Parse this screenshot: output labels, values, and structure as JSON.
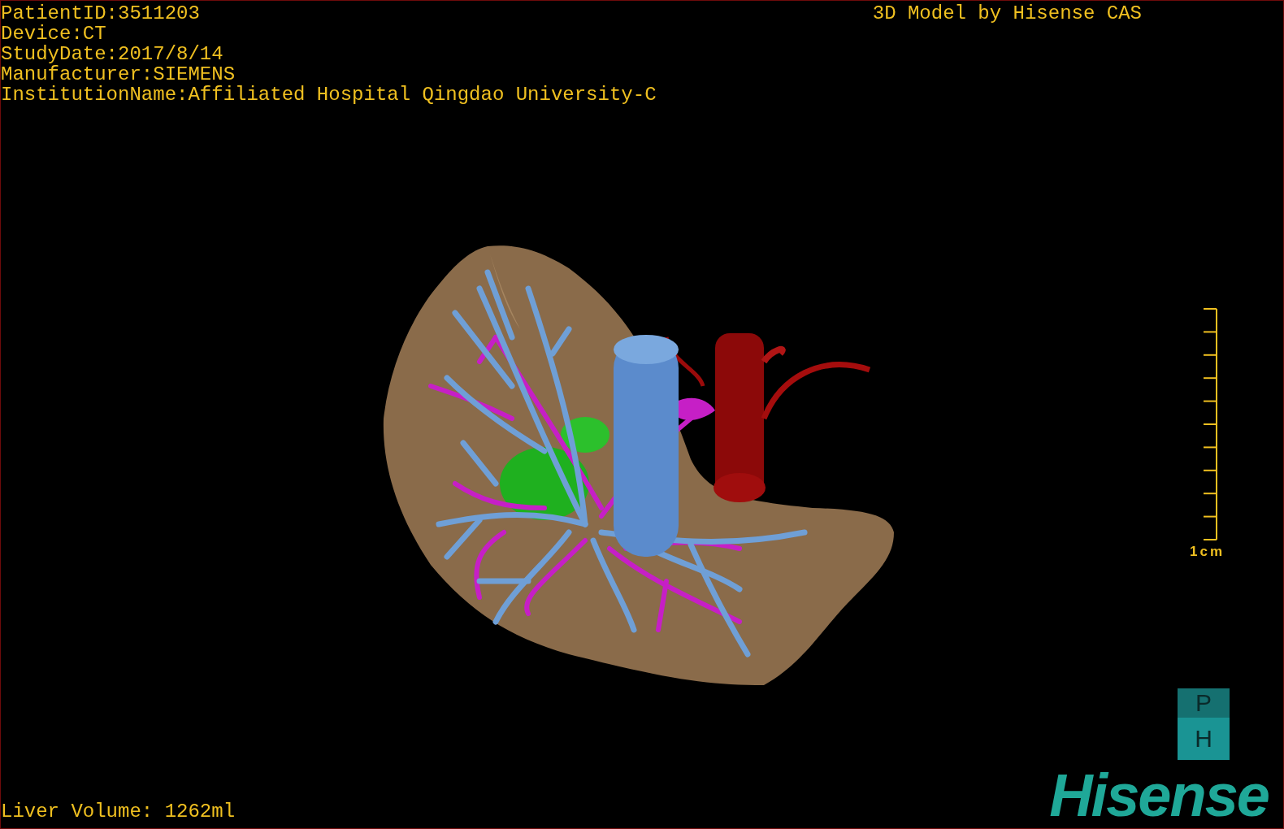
{
  "header": {
    "patient_info": [
      "PatientID:3511203",
      "Device:CT",
      "StudyDate:2017/8/14",
      "Manufacturer:SIEMENS",
      "InstitutionName:Affiliated Hospital Qingdao University-C"
    ],
    "model_credit": "3D Model by Hisense CAS"
  },
  "scale_bar": {
    "label": "1cm"
  },
  "footer": {
    "liver_volume": "Liver Volume: 1262ml",
    "badge": {
      "top": "P",
      "bottom": "H"
    },
    "logo": "Hisense"
  }
}
